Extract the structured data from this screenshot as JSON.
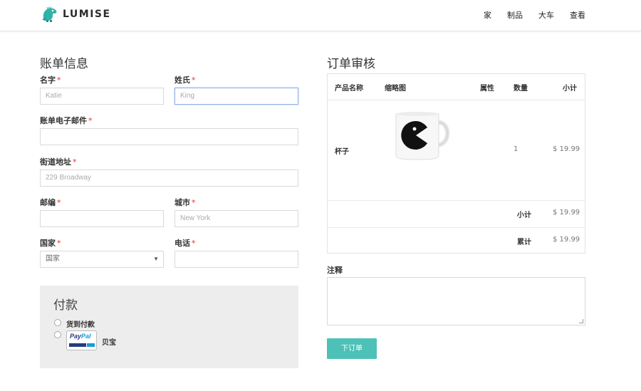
{
  "header": {
    "logo_text": "LUMISE",
    "nav": [
      "家",
      "制品",
      "大车",
      "查看"
    ]
  },
  "billing": {
    "title": "账单信息",
    "first_name_label": "名字",
    "first_name_value": "Katie",
    "last_name_label": "姓氏",
    "last_name_value": "King",
    "email_label": "账单电子邮件",
    "email_value": "",
    "street_label": "街道地址",
    "street_value": "229 Broadway",
    "zip_label": "邮编",
    "zip_value": "",
    "city_label": "城市",
    "city_value": "New York",
    "country_label": "国家",
    "country_selected": "国家",
    "phone_label": "电话",
    "phone_value": "",
    "required_mark": "*"
  },
  "payment": {
    "title": "付款",
    "cod_label": "货到付款",
    "paypal_label": "贝宝",
    "paypal_logo_a": "Pay",
    "paypal_logo_b": "Pal"
  },
  "order": {
    "title": "订单审核",
    "headers": {
      "name": "产品名称",
      "thumb": "缩略图",
      "attr": "属性",
      "qty": "数量",
      "subtotal": "小计"
    },
    "item": {
      "name": "杯子",
      "qty": "1",
      "price": "$ 19.99"
    },
    "subtotal_label": "小计",
    "subtotal_value": "$ 19.99",
    "total_label": "累计",
    "total_value": "$ 19.99",
    "notes_label": "注释",
    "place_order": "下订单"
  },
  "colors": {
    "accent": "#4dc1b8",
    "required": "#e03030",
    "focus_border": "#8fb1e6"
  }
}
